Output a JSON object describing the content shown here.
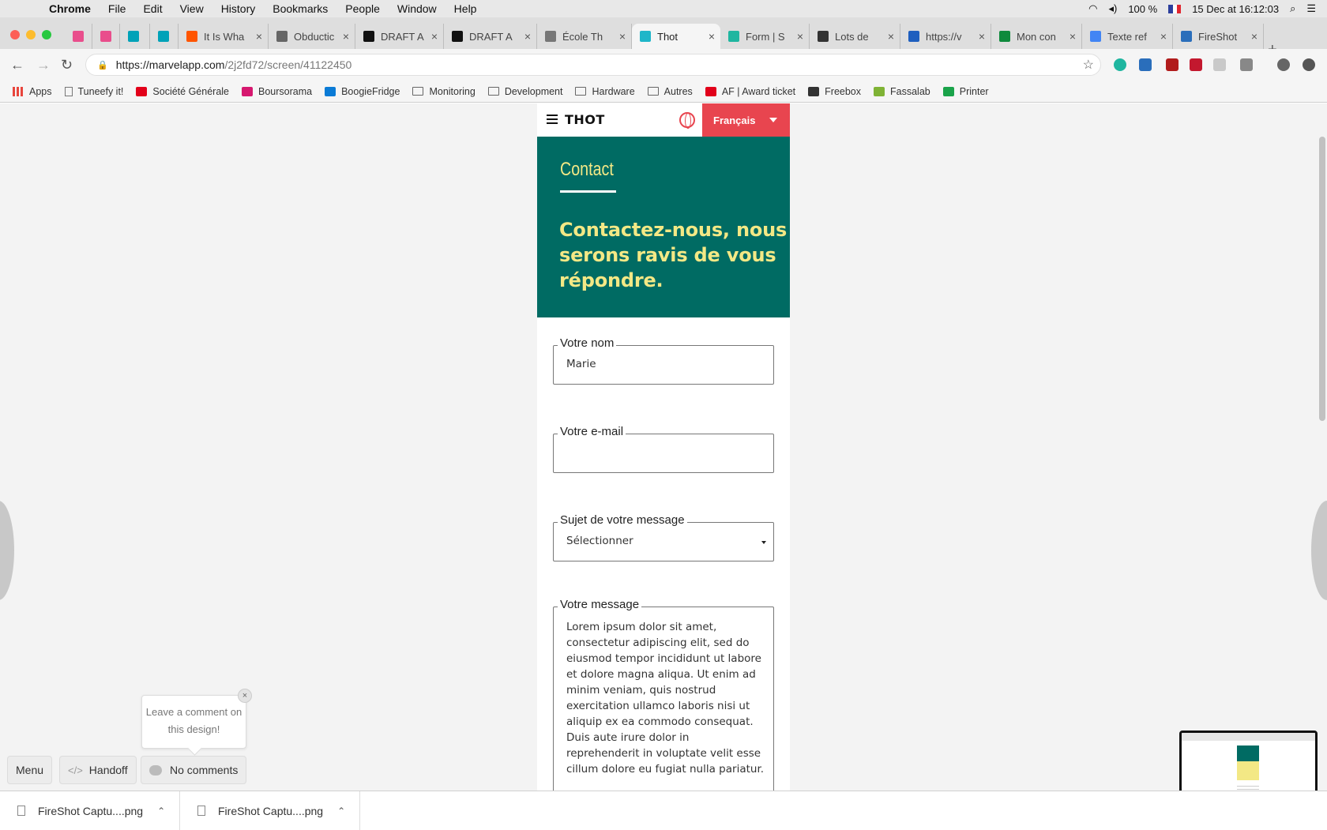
{
  "menubar": {
    "app": "Chrome",
    "items": [
      "File",
      "Edit",
      "View",
      "History",
      "Bookmarks",
      "People",
      "Window",
      "Help"
    ],
    "battery": "100 %",
    "datetime": "15 Dec at  16:12:03"
  },
  "tabs": [
    {
      "label": "",
      "color": "#e94e8c"
    },
    {
      "label": "",
      "color": "#e94e8c"
    },
    {
      "label": "",
      "color": "#00a2b8"
    },
    {
      "label": "",
      "color": "#00a2b8"
    },
    {
      "label": "It Is Wha",
      "color": "#ff5500"
    },
    {
      "label": "Obductic",
      "color": "#666666"
    },
    {
      "label": "DRAFT A",
      "color": "#111111"
    },
    {
      "label": "DRAFT A",
      "color": "#111111"
    },
    {
      "label": "École Th",
      "color": "#777777"
    },
    {
      "label": "Thot",
      "color": "#1fb6c9",
      "active": true
    },
    {
      "label": "Form | S",
      "color": "#1fb6a0"
    },
    {
      "label": "Lots de ",
      "color": "#333333"
    },
    {
      "label": "https://v",
      "color": "#1f5fbf"
    },
    {
      "label": "Mon con",
      "color": "#0f8a3c"
    },
    {
      "label": "Texte ref",
      "color": "#4285f4"
    },
    {
      "label": "FireShot",
      "color": "#2a6ebb"
    }
  ],
  "address": {
    "host": "https://marvelapp.com",
    "path": "/2j2fd72/screen/41122450"
  },
  "bookmarks": [
    {
      "label": "Apps",
      "type": "apps"
    },
    {
      "label": "Tuneefy it!",
      "type": "page"
    },
    {
      "label": "Société Générale",
      "type": "brand",
      "color": "#e2001a"
    },
    {
      "label": "Boursorama",
      "type": "brand",
      "color": "#d6186f"
    },
    {
      "label": "BoogieFridge",
      "type": "brand",
      "color": "#0b7bd6"
    },
    {
      "label": "Monitoring",
      "type": "folder"
    },
    {
      "label": "Development",
      "type": "folder"
    },
    {
      "label": "Hardware",
      "type": "folder"
    },
    {
      "label": "Autres",
      "type": "folder"
    },
    {
      "label": "AF | Award ticket",
      "type": "brand",
      "color": "#e1001a"
    },
    {
      "label": "Freebox",
      "type": "brand",
      "color": "#333333"
    },
    {
      "label": "Fassalab",
      "type": "brand",
      "color": "#7fb335"
    },
    {
      "label": "Printer",
      "type": "brand",
      "color": "#1aa34a"
    }
  ],
  "design": {
    "logo": "THOT",
    "language": "Français",
    "kicker": "Contact",
    "headline": "Contactez-nous, nous serons ravis de vous répondre.",
    "fields": {
      "name": {
        "label": "Votre nom",
        "value": "Marie"
      },
      "email": {
        "label": "Votre e-mail",
        "value": ""
      },
      "subject": {
        "label": "Sujet de votre message",
        "value": "Sélectionner"
      },
      "message": {
        "label": "Votre message",
        "value": "Lorem ipsum dolor sit amet, consectetur adipiscing elit, sed do eiusmod tempor incididunt ut labore et dolore magna aliqua. Ut enim ad minim veniam, quis nostrud exercitation ullamco laboris nisi ut aliquip ex ea commodo consequat. Duis aute irure dolor in reprehenderit in voluptate velit esse cillum dolore eu fugiat nulla pariatur."
      }
    },
    "colors": {
      "teal": "#006b63",
      "yellow": "#f3e885",
      "red": "#e8454f"
    }
  },
  "marvel": {
    "tooltip": "Leave a comment on this design!",
    "menu": "Menu",
    "handoff": "Handoff",
    "comments": "No comments"
  },
  "downloads": [
    {
      "label": "FireShot Captu....png"
    },
    {
      "label": "FireShot Captu....png"
    }
  ]
}
